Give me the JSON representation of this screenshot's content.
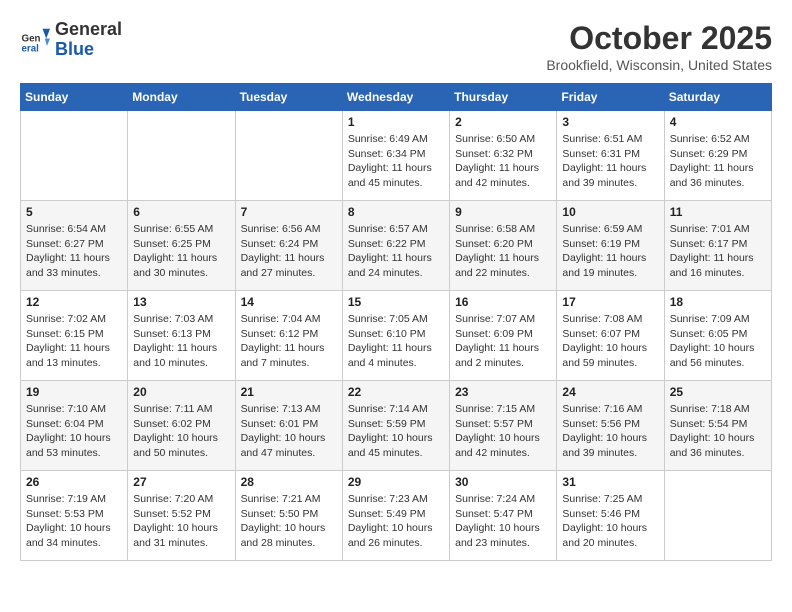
{
  "header": {
    "logo": {
      "line1": "General",
      "line2": "Blue"
    },
    "title": "October 2025",
    "location": "Brookfield, Wisconsin, United States"
  },
  "weekdays": [
    "Sunday",
    "Monday",
    "Tuesday",
    "Wednesday",
    "Thursday",
    "Friday",
    "Saturday"
  ],
  "weeks": [
    [
      {
        "day": null
      },
      {
        "day": null
      },
      {
        "day": null
      },
      {
        "day": 1,
        "sunrise": "6:49 AM",
        "sunset": "6:34 PM",
        "daylight": "11 hours and 45 minutes."
      },
      {
        "day": 2,
        "sunrise": "6:50 AM",
        "sunset": "6:32 PM",
        "daylight": "11 hours and 42 minutes."
      },
      {
        "day": 3,
        "sunrise": "6:51 AM",
        "sunset": "6:31 PM",
        "daylight": "11 hours and 39 minutes."
      },
      {
        "day": 4,
        "sunrise": "6:52 AM",
        "sunset": "6:29 PM",
        "daylight": "11 hours and 36 minutes."
      }
    ],
    [
      {
        "day": 5,
        "sunrise": "6:54 AM",
        "sunset": "6:27 PM",
        "daylight": "11 hours and 33 minutes."
      },
      {
        "day": 6,
        "sunrise": "6:55 AM",
        "sunset": "6:25 PM",
        "daylight": "11 hours and 30 minutes."
      },
      {
        "day": 7,
        "sunrise": "6:56 AM",
        "sunset": "6:24 PM",
        "daylight": "11 hours and 27 minutes."
      },
      {
        "day": 8,
        "sunrise": "6:57 AM",
        "sunset": "6:22 PM",
        "daylight": "11 hours and 24 minutes."
      },
      {
        "day": 9,
        "sunrise": "6:58 AM",
        "sunset": "6:20 PM",
        "daylight": "11 hours and 22 minutes."
      },
      {
        "day": 10,
        "sunrise": "6:59 AM",
        "sunset": "6:19 PM",
        "daylight": "11 hours and 19 minutes."
      },
      {
        "day": 11,
        "sunrise": "7:01 AM",
        "sunset": "6:17 PM",
        "daylight": "11 hours and 16 minutes."
      }
    ],
    [
      {
        "day": 12,
        "sunrise": "7:02 AM",
        "sunset": "6:15 PM",
        "daylight": "11 hours and 13 minutes."
      },
      {
        "day": 13,
        "sunrise": "7:03 AM",
        "sunset": "6:13 PM",
        "daylight": "11 hours and 10 minutes."
      },
      {
        "day": 14,
        "sunrise": "7:04 AM",
        "sunset": "6:12 PM",
        "daylight": "11 hours and 7 minutes."
      },
      {
        "day": 15,
        "sunrise": "7:05 AM",
        "sunset": "6:10 PM",
        "daylight": "11 hours and 4 minutes."
      },
      {
        "day": 16,
        "sunrise": "7:07 AM",
        "sunset": "6:09 PM",
        "daylight": "11 hours and 2 minutes."
      },
      {
        "day": 17,
        "sunrise": "7:08 AM",
        "sunset": "6:07 PM",
        "daylight": "10 hours and 59 minutes."
      },
      {
        "day": 18,
        "sunrise": "7:09 AM",
        "sunset": "6:05 PM",
        "daylight": "10 hours and 56 minutes."
      }
    ],
    [
      {
        "day": 19,
        "sunrise": "7:10 AM",
        "sunset": "6:04 PM",
        "daylight": "10 hours and 53 minutes."
      },
      {
        "day": 20,
        "sunrise": "7:11 AM",
        "sunset": "6:02 PM",
        "daylight": "10 hours and 50 minutes."
      },
      {
        "day": 21,
        "sunrise": "7:13 AM",
        "sunset": "6:01 PM",
        "daylight": "10 hours and 47 minutes."
      },
      {
        "day": 22,
        "sunrise": "7:14 AM",
        "sunset": "5:59 PM",
        "daylight": "10 hours and 45 minutes."
      },
      {
        "day": 23,
        "sunrise": "7:15 AM",
        "sunset": "5:57 PM",
        "daylight": "10 hours and 42 minutes."
      },
      {
        "day": 24,
        "sunrise": "7:16 AM",
        "sunset": "5:56 PM",
        "daylight": "10 hours and 39 minutes."
      },
      {
        "day": 25,
        "sunrise": "7:18 AM",
        "sunset": "5:54 PM",
        "daylight": "10 hours and 36 minutes."
      }
    ],
    [
      {
        "day": 26,
        "sunrise": "7:19 AM",
        "sunset": "5:53 PM",
        "daylight": "10 hours and 34 minutes."
      },
      {
        "day": 27,
        "sunrise": "7:20 AM",
        "sunset": "5:52 PM",
        "daylight": "10 hours and 31 minutes."
      },
      {
        "day": 28,
        "sunrise": "7:21 AM",
        "sunset": "5:50 PM",
        "daylight": "10 hours and 28 minutes."
      },
      {
        "day": 29,
        "sunrise": "7:23 AM",
        "sunset": "5:49 PM",
        "daylight": "10 hours and 26 minutes."
      },
      {
        "day": 30,
        "sunrise": "7:24 AM",
        "sunset": "5:47 PM",
        "daylight": "10 hours and 23 minutes."
      },
      {
        "day": 31,
        "sunrise": "7:25 AM",
        "sunset": "5:46 PM",
        "daylight": "10 hours and 20 minutes."
      },
      {
        "day": null
      }
    ]
  ]
}
